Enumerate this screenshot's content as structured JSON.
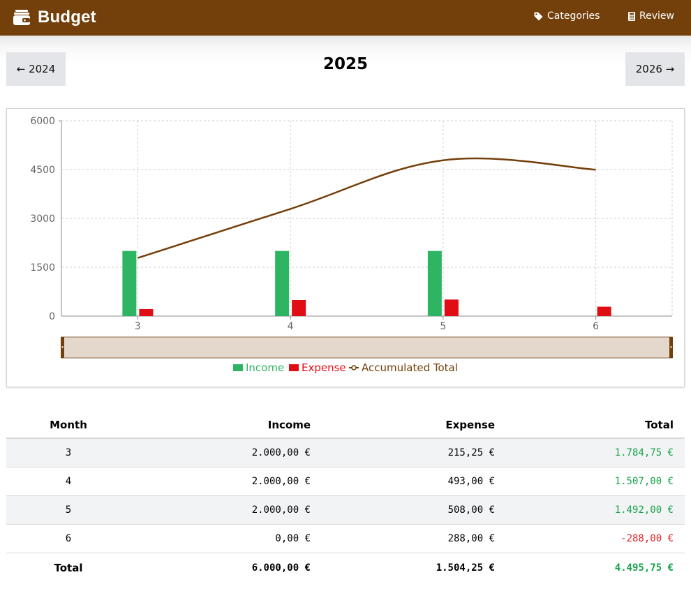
{
  "app": {
    "title": "Budget",
    "nav": [
      {
        "label": "Categories",
        "icon": "tag-icon"
      },
      {
        "label": "Review",
        "icon": "calculator-icon"
      }
    ]
  },
  "year_nav": {
    "prev_label": "← 2024",
    "current": "2025",
    "next_label": "2026 →"
  },
  "colors": {
    "header": "#733f0a",
    "income": "#2eb563",
    "expense": "#e00d15",
    "accumulated": "#733f0a",
    "slider_fill": "#e4d8cc",
    "positive_text": "#16a34a",
    "negative_text": "#dc2626"
  },
  "chart_data": {
    "type": "bar",
    "categories": [
      "3",
      "4",
      "5",
      "6"
    ],
    "series": [
      {
        "name": "Income",
        "type": "bar",
        "values": [
          2000,
          2000,
          2000,
          0
        ]
      },
      {
        "name": "Expense",
        "type": "bar",
        "values": [
          215.25,
          493,
          508,
          288
        ]
      },
      {
        "name": "Accumulated Total",
        "type": "line",
        "values": [
          1784.75,
          3291.75,
          4783.75,
          4495.75
        ]
      }
    ],
    "yticks": [
      0,
      1500,
      3000,
      4500,
      6000
    ],
    "ylim": [
      0,
      6000
    ],
    "grid": true,
    "legend": "bottom-center",
    "zoom_slider": true
  },
  "table": {
    "headers": [
      "Month",
      "Income",
      "Expense",
      "Total"
    ],
    "rows": [
      {
        "month": "3",
        "income": "2.000,00 €",
        "expense": "215,25 €",
        "total": "1.784,75 €",
        "sign": "pos"
      },
      {
        "month": "4",
        "income": "2.000,00 €",
        "expense": "493,00 €",
        "total": "1.507,00 €",
        "sign": "pos"
      },
      {
        "month": "5",
        "income": "2.000,00 €",
        "expense": "508,00 €",
        "total": "1.492,00 €",
        "sign": "pos"
      },
      {
        "month": "6",
        "income": "0,00 €",
        "expense": "288,00 €",
        "total": "-288,00 €",
        "sign": "neg"
      }
    ],
    "footer": {
      "label": "Total",
      "income": "6.000,00 €",
      "expense": "1.504,25 €",
      "total": "4.495,75 €",
      "sign": "pos"
    }
  }
}
